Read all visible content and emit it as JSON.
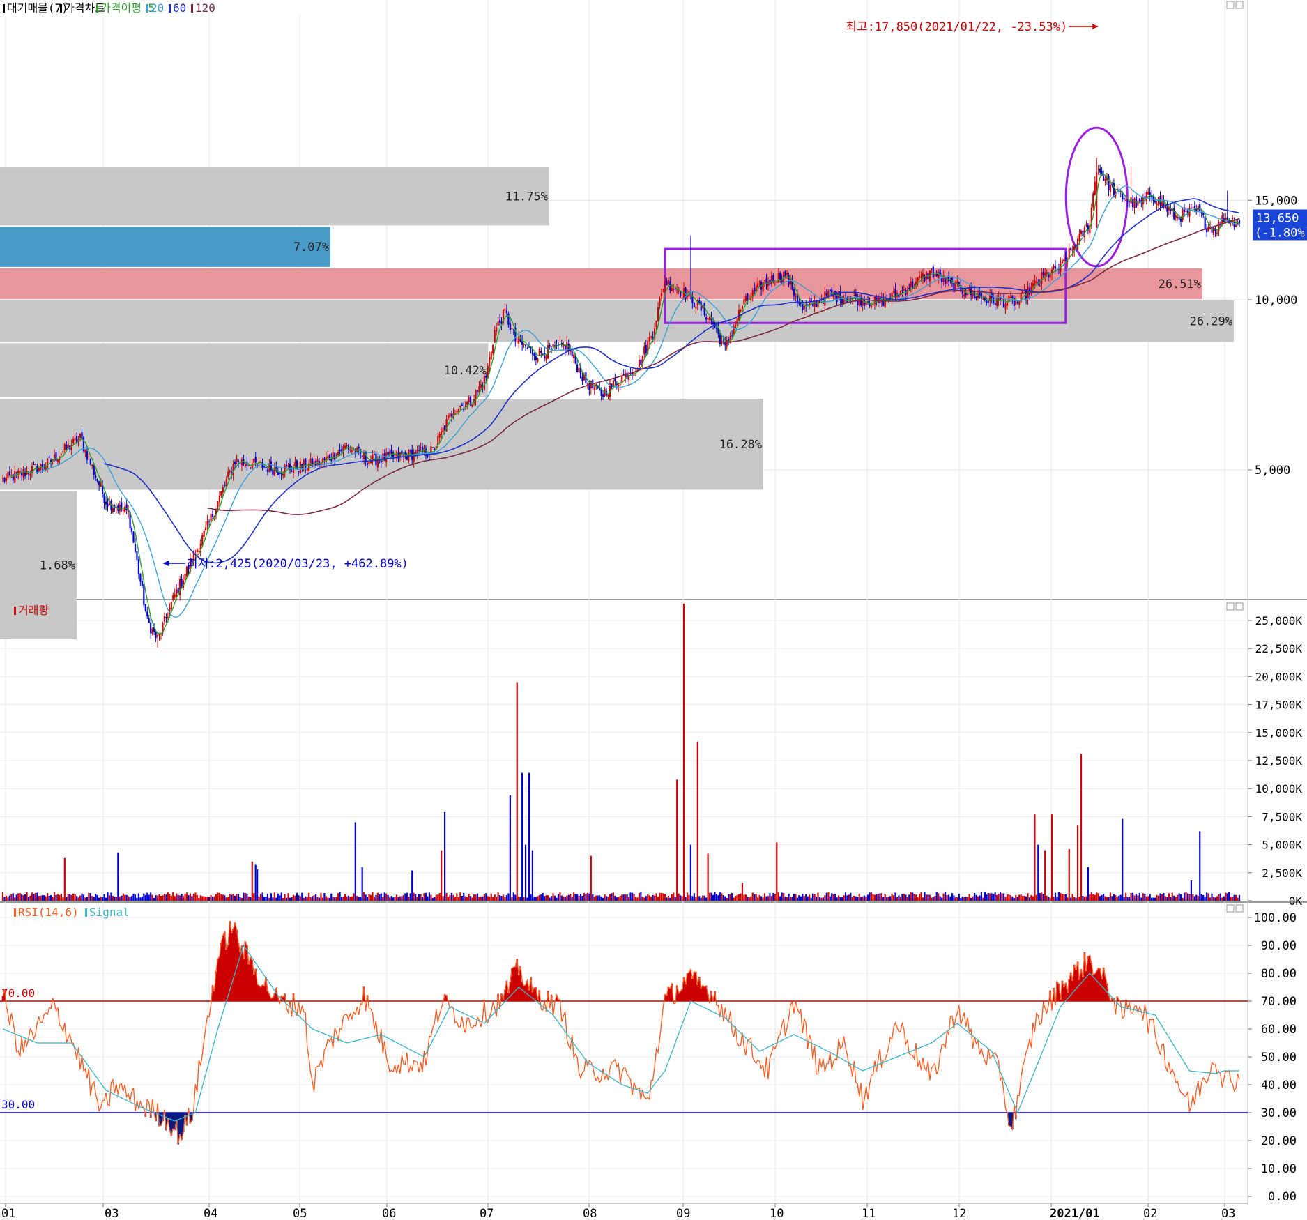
{
  "colors": {
    "up": "#cc0000",
    "down": "#0000cc",
    "ma5": "#2ca02c",
    "ma20": "#3aa0d8",
    "ma60": "#1a2fc8",
    "ma120": "#7a2840",
    "rsi": "#ff5a1e",
    "signal": "#3cb4c8",
    "highlight": "#9a20e0",
    "current_price_bg": "#1a44d8",
    "volume_profile_gray": "#c8c8c8",
    "volume_profile_blue": "#4a9ac8",
    "volume_profile_red": "#e8969c"
  },
  "legend": {
    "price": [
      {
        "label": "대기매물(7)",
        "color": "#000000"
      },
      {
        "label": "가격차트",
        "color": "#000000"
      },
      {
        "label": "가격이평 5",
        "color": "#2ca02c"
      },
      {
        "label": "20",
        "color": "#3aa0d8"
      },
      {
        "label": "60",
        "color": "#1a2fc8"
      },
      {
        "label": "120",
        "color": "#7a2840"
      }
    ],
    "volume": [
      {
        "label": "거래량",
        "color": "#cc0000"
      }
    ],
    "rsi": [
      {
        "label": "RSI(14,6)",
        "color": "#ff5a1e"
      },
      {
        "label": "Signal",
        "color": "#3cb4c8"
      }
    ]
  },
  "annotations": {
    "high": "최고:17,850(2021/01/22, -23.53%)",
    "low": "최저:2,425(2020/03/23, +462.89%)",
    "current_price": "13,650",
    "current_change": "(-1.80%)"
  },
  "chart_data": [
    {
      "type": "candlestick",
      "title": "가격차트",
      "y_scale": "log",
      "ylim": [
        2000,
        22000
      ],
      "y_ticks": [
        5000,
        10000,
        15000
      ],
      "y_tick_labels": [
        "5,000",
        "10,000",
        "15,000"
      ],
      "x_tick_labels": [
        "01",
        "03",
        "04",
        "05",
        "06",
        "07",
        "08",
        "09",
        "10",
        "11",
        "12",
        "2021/01",
        "02",
        "03"
      ],
      "last_close": 13650,
      "high": {
        "value": 17850,
        "date": "2021/01/22"
      },
      "low": {
        "value": 2425,
        "date": "2020/03/23"
      },
      "close_anchors": [
        [
          0,
          4800
        ],
        [
          25,
          5100
        ],
        [
          45,
          5700
        ],
        [
          60,
          4400
        ],
        [
          73,
          4200
        ],
        [
          84,
          2700
        ],
        [
          90,
          2500
        ],
        [
          100,
          3000
        ],
        [
          118,
          3900
        ],
        [
          135,
          5200
        ],
        [
          160,
          5000
        ],
        [
          185,
          5150
        ],
        [
          200,
          5500
        ],
        [
          213,
          5200
        ],
        [
          232,
          5300
        ],
        [
          250,
          5400
        ],
        [
          262,
          6400
        ],
        [
          272,
          6600
        ],
        [
          281,
          7300
        ],
        [
          286,
          8800
        ],
        [
          292,
          9500
        ],
        [
          298,
          8500
        ],
        [
          310,
          8000
        ],
        [
          328,
          8300
        ],
        [
          338,
          7200
        ],
        [
          348,
          6800
        ],
        [
          370,
          7700
        ],
        [
          378,
          8800
        ],
        [
          385,
          10800
        ],
        [
          400,
          10100
        ],
        [
          412,
          9200
        ],
        [
          420,
          8200
        ],
        [
          430,
          9800
        ],
        [
          442,
          10700
        ],
        [
          455,
          11100
        ],
        [
          465,
          9600
        ],
        [
          480,
          10200
        ],
        [
          510,
          9900
        ],
        [
          522,
          10300
        ],
        [
          540,
          11200
        ],
        [
          552,
          10600
        ],
        [
          572,
          10000
        ],
        [
          590,
          9900
        ],
        [
          605,
          11000
        ],
        [
          615,
          11400
        ],
        [
          622,
          12300
        ],
        [
          632,
          13700
        ],
        [
          636,
          17200
        ],
        [
          646,
          15500
        ],
        [
          660,
          14700
        ],
        [
          668,
          15400
        ],
        [
          682,
          14000
        ],
        [
          695,
          14400
        ],
        [
          700,
          13500
        ],
        [
          706,
          13400
        ],
        [
          710,
          14000
        ],
        [
          720,
          13650
        ]
      ],
      "volume_profile": [
        {
          "price_range": [
            13500,
            17200
          ],
          "percent": "11.75%"
        },
        {
          "price_range": [
            11400,
            13500
          ],
          "percent": "7.07%"
        },
        {
          "price_range": [
            10000,
            11400
          ],
          "percent": "26.51%"
        },
        {
          "price_range": [
            8400,
            10000
          ],
          "percent": "26.29%"
        },
        {
          "price_range": [
            6700,
            8400
          ],
          "percent": "10.42%"
        },
        {
          "price_range": [
            4600,
            6700
          ],
          "percent": "16.28%"
        },
        {
          "price_range": [
            2500,
            4600
          ],
          "percent": "1.68%"
        }
      ]
    },
    {
      "type": "bar",
      "title": "거래량",
      "ylim": [
        0,
        26500
      ],
      "y_unit": "K",
      "y_ticks": [
        0,
        2500,
        5000,
        7500,
        10000,
        12500,
        15000,
        17500,
        20000,
        22500,
        25000
      ],
      "y_tick_labels": [
        "0K",
        "2,500K",
        "5,000K",
        "7,500K",
        "10,000K",
        "12,500K",
        "15,000K",
        "17,500K",
        "20,000K",
        "22,500K",
        "25,000K"
      ],
      "spikes": [
        [
          36,
          3800
        ],
        [
          67,
          4300
        ],
        [
          145,
          3500
        ],
        [
          147,
          3200
        ],
        [
          148,
          2800
        ],
        [
          205,
          7000
        ],
        [
          209,
          3000
        ],
        [
          238,
          2700
        ],
        [
          255,
          4500
        ],
        [
          257,
          7900
        ],
        [
          295,
          9400
        ],
        [
          299,
          19500
        ],
        [
          302,
          11400
        ],
        [
          304,
          5000
        ],
        [
          306,
          11400
        ],
        [
          308,
          4500
        ],
        [
          342,
          4000
        ],
        [
          392,
          10800
        ],
        [
          396,
          26500
        ],
        [
          400,
          5000
        ],
        [
          404,
          14200
        ],
        [
          410,
          4200
        ],
        [
          430,
          1600
        ],
        [
          450,
          5200
        ],
        [
          600,
          7700
        ],
        [
          602,
          5000
        ],
        [
          606,
          4500
        ],
        [
          610,
          7700
        ],
        [
          620,
          4600
        ],
        [
          625,
          6700
        ],
        [
          627,
          13100
        ],
        [
          631,
          3000
        ],
        [
          651,
          7300
        ],
        [
          691,
          1800
        ],
        [
          696,
          6200
        ]
      ]
    },
    {
      "type": "line",
      "title": "RSI(14,6)",
      "ylim": [
        0,
        100
      ],
      "y_ticks": [
        0,
        10,
        20,
        30,
        40,
        50,
        60,
        70,
        80,
        90,
        100
      ],
      "y_tick_labels": [
        "0.00",
        "10.00",
        "20.00",
        "30.00",
        "40.00",
        "50.00",
        "60.00",
        "70.00",
        "80.00",
        "90.00",
        "100.00"
      ],
      "levels": [
        {
          "value": 70,
          "label": "70.00"
        },
        {
          "value": 30,
          "label": "30.00"
        }
      ],
      "series": [
        {
          "name": "RSI(14,6)",
          "anchors": [
            [
              0,
              72
            ],
            [
              10,
              52
            ],
            [
              30,
              68
            ],
            [
              40,
              56
            ],
            [
              58,
              30
            ],
            [
              65,
              40
            ],
            [
              80,
              33
            ],
            [
              95,
              28
            ],
            [
              103,
              22
            ],
            [
              110,
              30
            ],
            [
              125,
              85
            ],
            [
              133,
              97
            ],
            [
              140,
              88
            ],
            [
              150,
              78
            ],
            [
              160,
              70
            ],
            [
              175,
              68
            ],
            [
              180,
              40
            ],
            [
              190,
              55
            ],
            [
              210,
              72
            ],
            [
              225,
              48
            ],
            [
              245,
              48
            ],
            [
              255,
              70
            ],
            [
              270,
              62
            ],
            [
              290,
              70
            ],
            [
              300,
              82
            ],
            [
              308,
              73
            ],
            [
              325,
              67
            ],
            [
              335,
              45
            ],
            [
              360,
              45
            ],
            [
              375,
              33
            ],
            [
              385,
              70
            ],
            [
              398,
              78
            ],
            [
              413,
              73
            ],
            [
              425,
              60
            ],
            [
              445,
              45
            ],
            [
              460,
              70
            ],
            [
              475,
              45
            ],
            [
              490,
              55
            ],
            [
              500,
              35
            ],
            [
              520,
              62
            ],
            [
              540,
              42
            ],
            [
              555,
              68
            ],
            [
              565,
              55
            ],
            [
              580,
              45
            ],
            [
              586,
              24
            ],
            [
              600,
              62
            ],
            [
              615,
              75
            ],
            [
              632,
              85
            ],
            [
              643,
              75
            ],
            [
              650,
              65
            ],
            [
              660,
              70
            ],
            [
              675,
              52
            ],
            [
              690,
              32
            ],
            [
              705,
              50
            ],
            [
              710,
              42
            ]
          ]
        },
        {
          "name": "Signal",
          "anchors": [
            [
              0,
              60
            ],
            [
              20,
              55
            ],
            [
              40,
              55
            ],
            [
              60,
              38
            ],
            [
              80,
              32
            ],
            [
              100,
              27
            ],
            [
              112,
              30
            ],
            [
              125,
              60
            ],
            [
              140,
              90
            ],
            [
              160,
              72
            ],
            [
              180,
              60
            ],
            [
              200,
              55
            ],
            [
              220,
              58
            ],
            [
              245,
              50
            ],
            [
              260,
              68
            ],
            [
              280,
              62
            ],
            [
              300,
              75
            ],
            [
              320,
              65
            ],
            [
              340,
              48
            ],
            [
              360,
              40
            ],
            [
              375,
              37
            ],
            [
              385,
              45
            ],
            [
              400,
              70
            ],
            [
              420,
              64
            ],
            [
              440,
              52
            ],
            [
              460,
              58
            ],
            [
              480,
              52
            ],
            [
              500,
              45
            ],
            [
              520,
              50
            ],
            [
              540,
              55
            ],
            [
              555,
              62
            ],
            [
              575,
              52
            ],
            [
              590,
              30
            ],
            [
              600,
              45
            ],
            [
              615,
              68
            ],
            [
              632,
              80
            ],
            [
              650,
              68
            ],
            [
              670,
              65
            ],
            [
              690,
              45
            ],
            [
              705,
              44
            ],
            [
              710,
              45
            ]
          ]
        }
      ]
    }
  ]
}
